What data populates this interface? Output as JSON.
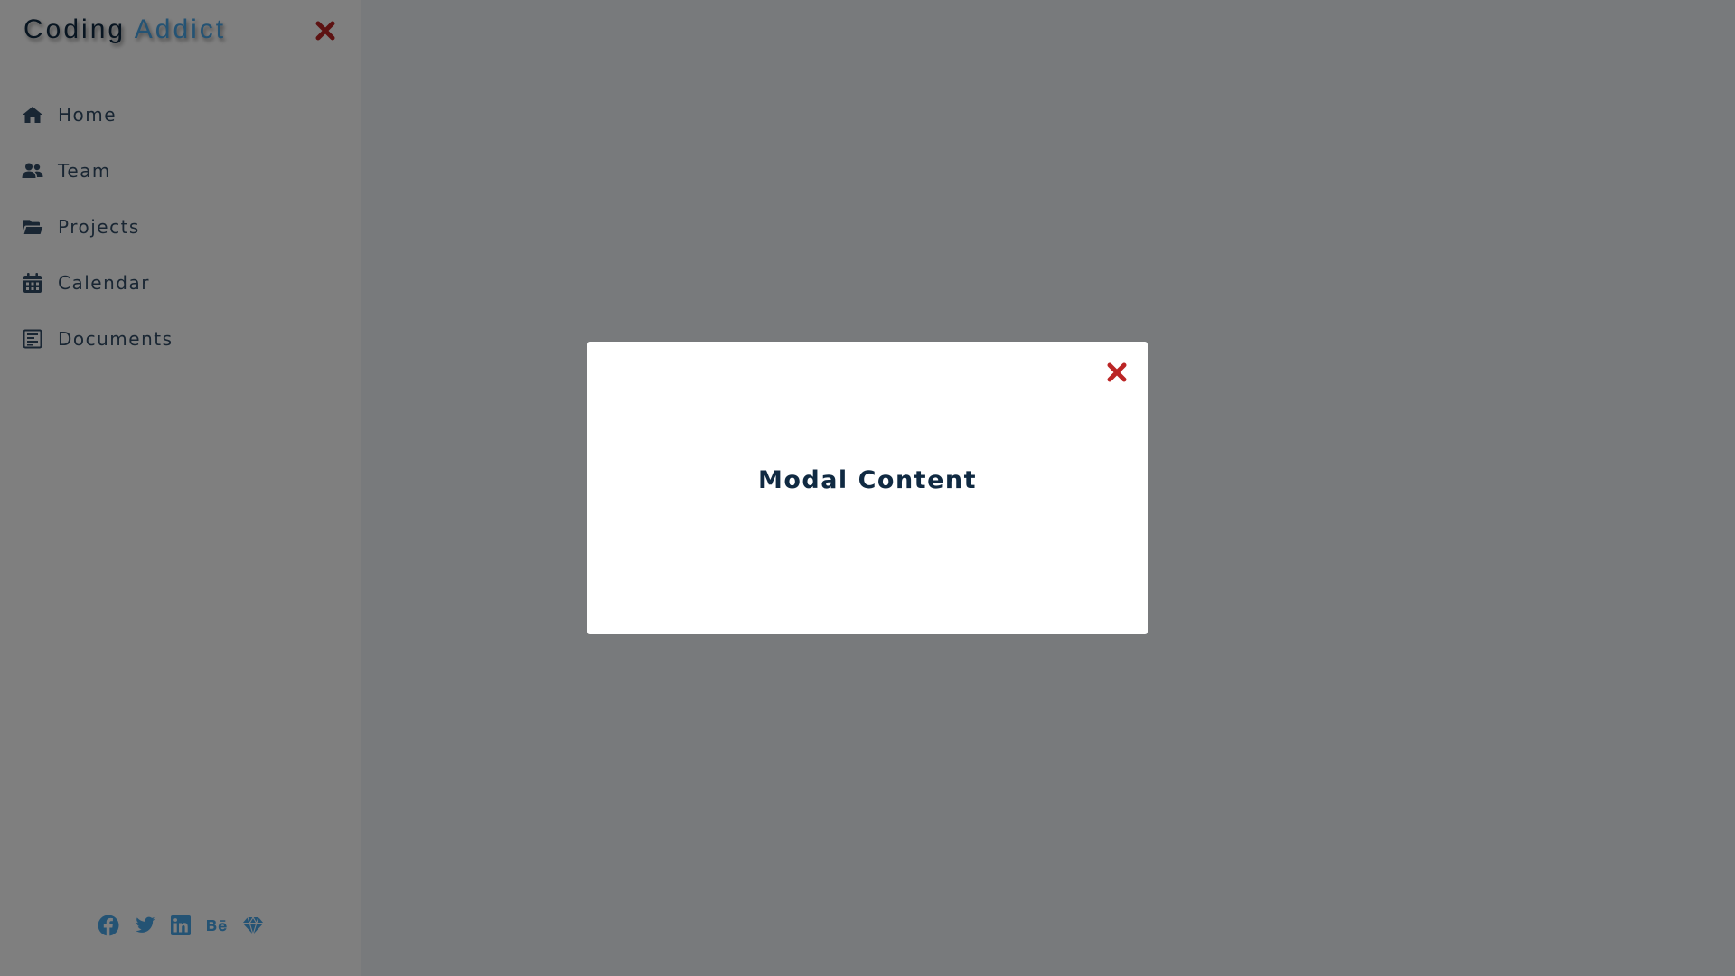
{
  "sidebar": {
    "logo": {
      "primary": "Coding",
      "accent": "Addict"
    },
    "close_icon": "close-icon",
    "items": [
      {
        "label": "Home",
        "icon": "home-icon"
      },
      {
        "label": "Team",
        "icon": "users-icon"
      },
      {
        "label": "Projects",
        "icon": "folder-open-icon"
      },
      {
        "label": "Calendar",
        "icon": "calendar-icon"
      },
      {
        "label": "Documents",
        "icon": "document-icon"
      }
    ],
    "social": [
      {
        "icon": "facebook-icon"
      },
      {
        "icon": "twitter-icon"
      },
      {
        "icon": "linkedin-icon"
      },
      {
        "icon": "behance-icon"
      },
      {
        "icon": "sketch-icon"
      }
    ]
  },
  "modal": {
    "title": "Modal Content",
    "close_icon": "close-icon"
  },
  "colors": {
    "accent": "#49a6e9",
    "text_dark": "#102a42",
    "text_nav": "#324d67",
    "close_red": "#bb2525",
    "overlay": "rgba(0,0,0,0.5)"
  }
}
